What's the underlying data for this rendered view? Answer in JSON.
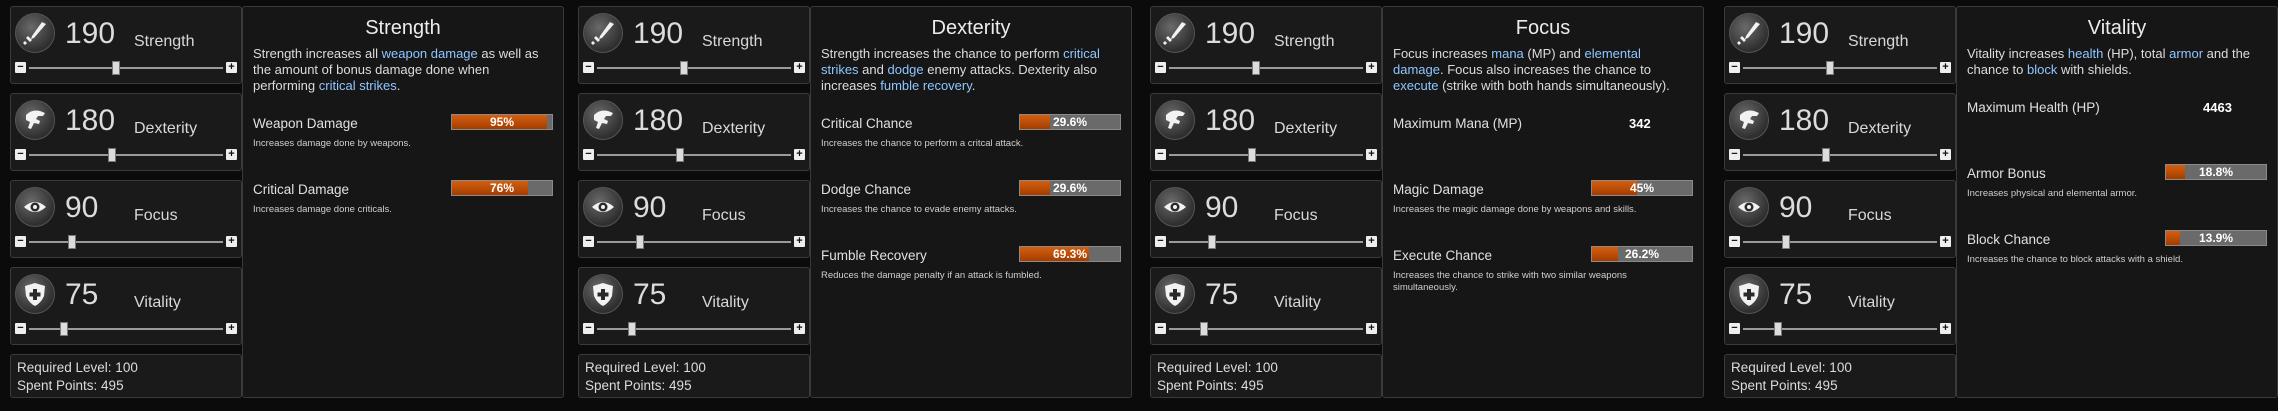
{
  "stats": [
    {
      "name": "Strength",
      "value": "190",
      "icon": "sword-icon",
      "level": 0.45
    },
    {
      "name": "Dexterity",
      "value": "180",
      "icon": "raptor-icon",
      "level": 0.43
    },
    {
      "name": "Focus",
      "value": "90",
      "icon": "eye-icon",
      "level": 0.22
    },
    {
      "name": "Vitality",
      "value": "75",
      "icon": "shield-icon",
      "level": 0.18
    }
  ],
  "required_level_label": "Required Level: 100",
  "spent_points_label": "Spent Points: 495",
  "panels": [
    {
      "title": "Strength",
      "desc": [
        {
          "t": "Strength increases all "
        },
        {
          "t": "weapon damage",
          "h": true
        },
        {
          "t": " as well as the amount of bonus damage done when performing "
        },
        {
          "t": "critical strikes",
          "h": true
        },
        {
          "t": "."
        }
      ],
      "rows": [
        {
          "label": "Weapon Damage",
          "value": "95%",
          "fill": 0.95,
          "note": "Increases damage done by weapons."
        },
        {
          "label": "Critical Damage",
          "value": "76%",
          "fill": 0.76,
          "note": "Increases damage done criticals."
        }
      ]
    },
    {
      "title": "Dexterity",
      "desc": [
        {
          "t": "Strength increases the chance to perform "
        },
        {
          "t": "critical strikes",
          "h": true
        },
        {
          "t": " and "
        },
        {
          "t": "dodge",
          "h": true
        },
        {
          "t": " enemy attacks. Dexterity also increases "
        },
        {
          "t": "fumble recovery",
          "h": true
        },
        {
          "t": "."
        }
      ],
      "rows": [
        {
          "label": "Critical Chance",
          "value": "29.6%",
          "fill": 0.296,
          "note": "Increases the chance to perform a critcal attack."
        },
        {
          "label": "Dodge Chance",
          "value": "29.6%",
          "fill": 0.296,
          "note": "Increases the chance to evade enemy attacks."
        },
        {
          "label": "Fumble Recovery",
          "value": "69.3%",
          "fill": 0.693,
          "note": "Reduces the damage penalty if an attack is fumbled."
        }
      ]
    },
    {
      "title": "Focus",
      "desc": [
        {
          "t": "Focus increases "
        },
        {
          "t": "mana",
          "h": true
        },
        {
          "t": " (MP) and "
        },
        {
          "t": "elemental damage",
          "h": true
        },
        {
          "t": ". Focus also increases the chance to "
        },
        {
          "t": "execute",
          "h": true
        },
        {
          "t": " (strike with both hands simultaneously)."
        }
      ],
      "rows": [
        {
          "label": "Maximum Mana (MP)",
          "value": "342",
          "plain": true,
          "note": ""
        },
        {
          "label": "Magic Damage",
          "value": "45%",
          "fill": 0.45,
          "note": "Increases the magic damage done by weapons and skills."
        },
        {
          "label": "Execute Chance",
          "value": "26.2%",
          "fill": 0.262,
          "note": "Increases the chance to strike with two similar weapons simultaneously."
        }
      ]
    },
    {
      "title": "Vitality",
      "desc": [
        {
          "t": "Vitality increases "
        },
        {
          "t": "health",
          "h": true
        },
        {
          "t": " (HP), total "
        },
        {
          "t": "armor",
          "h": true
        },
        {
          "t": " and the chance to "
        },
        {
          "t": "block",
          "h": true
        },
        {
          "t": " with shields."
        }
      ],
      "rows": [
        {
          "label": "Maximum Health (HP)",
          "value": "4463",
          "plain": true,
          "note": ""
        },
        {
          "label": "Armor Bonus",
          "value": "18.8%",
          "fill": 0.188,
          "note": "Increases physical and elemental armor."
        },
        {
          "label": "Block Chance",
          "value": "13.9%",
          "fill": 0.139,
          "note": "Increases the chance to block attacks with a shield."
        }
      ]
    }
  ]
}
